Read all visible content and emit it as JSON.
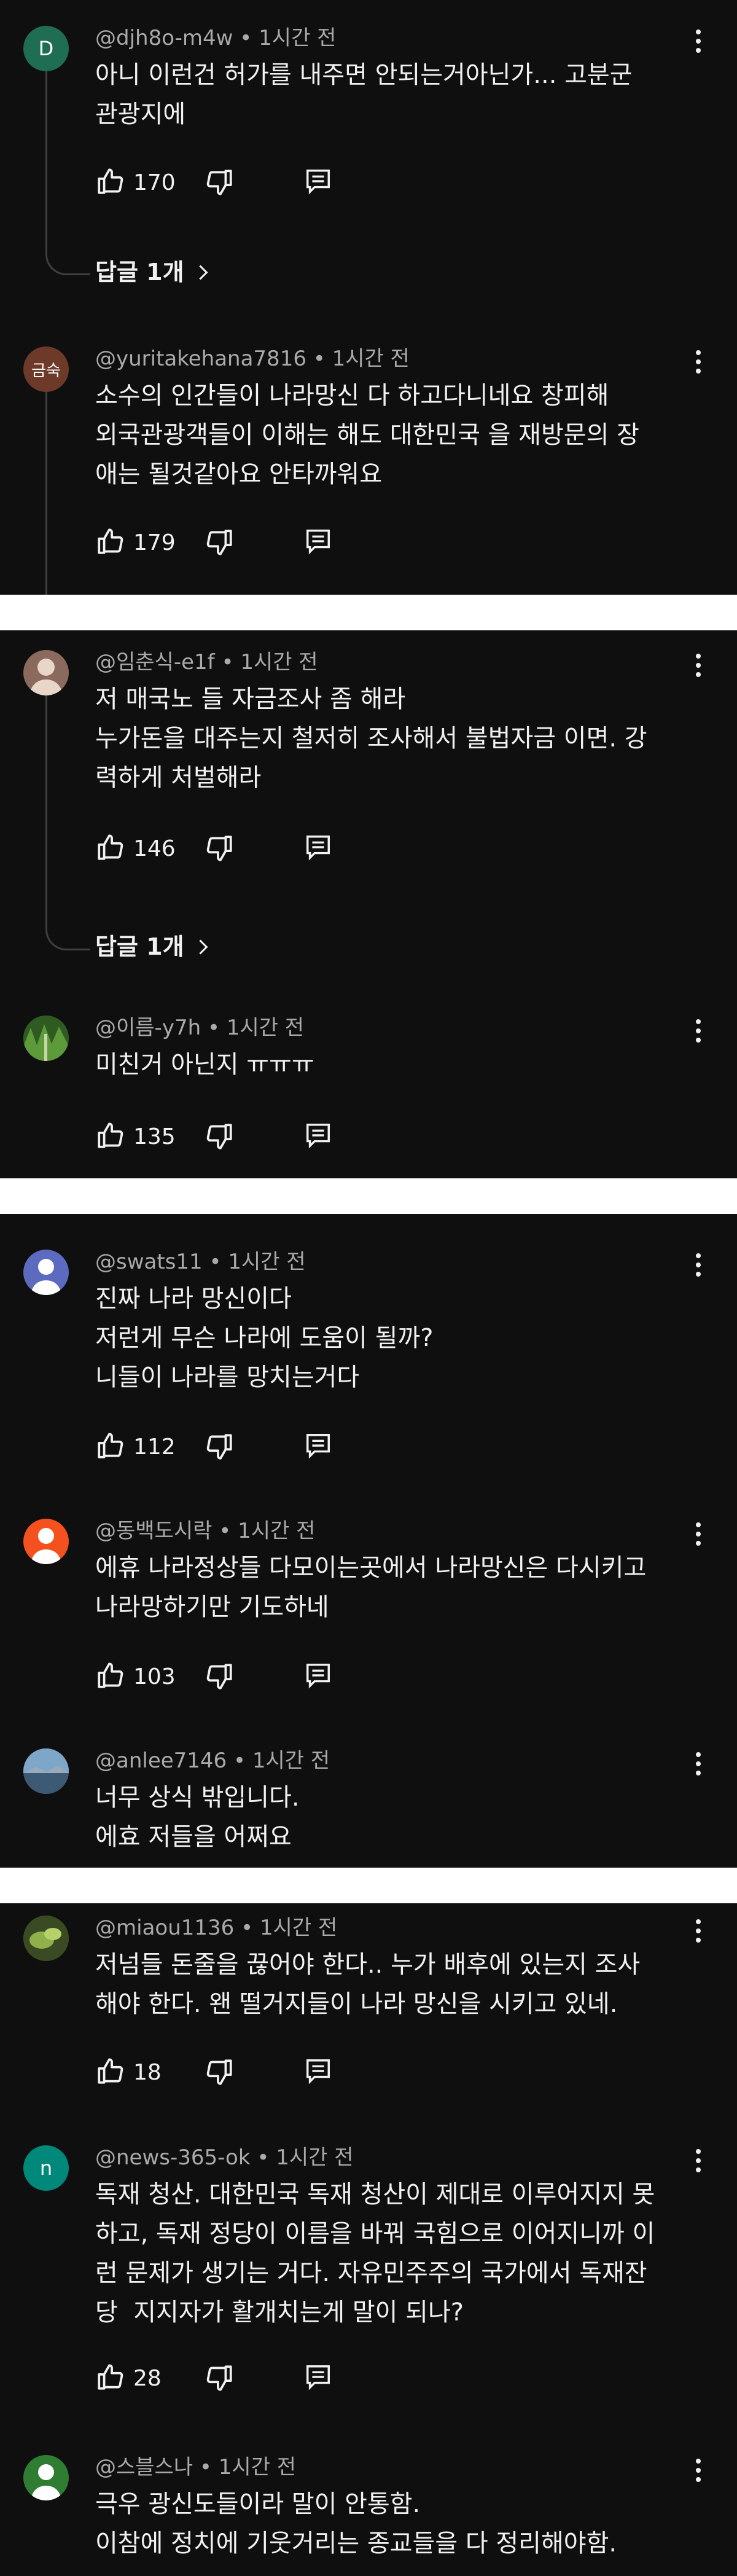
{
  "comments": [
    {
      "author": "@djh8o-m4w",
      "time": "1시간 전",
      "text": "아니 이런건 허가를 내주면 안되는거아닌가... 고분군\n관광지에",
      "likes": "170",
      "avatar": {
        "letter": "D",
        "color": "#1f6d52"
      }
    },
    {
      "author": "@yuritakehana7816",
      "time": "1시간 전",
      "text": "소수의 인간들이 나라망신 다 하고다니네요 창피해\n외국관광객들이 이해는 해도 대한민국 을 재방문의 장\n애는 될것같아요 안타까워요",
      "likes": "179",
      "avatar": {
        "letter": "금숙",
        "color": "#6d3a2a"
      }
    },
    {
      "author": "@임춘식-e1f",
      "time": "1시간 전",
      "text": "저 매국노 들 자금조사 좀 해라\n누가돈을 대주는지 철저히 조사해서 불법자금 이면. 강\n력하게 처벌해라",
      "likes": "146",
      "avatar": {
        "letter": "",
        "color": "#8a6a5c"
      }
    },
    {
      "author": "@이름-y7h",
      "time": "1시간 전",
      "text": "미친거 아닌지 ㅠㅠㅠ",
      "likes": "135",
      "avatar": {
        "letter": "",
        "color": "#3f6a2a"
      }
    },
    {
      "author": "@swats11",
      "time": "1시간 전",
      "text": "진짜 나라 망신이다\n저런게 무슨 나라에 도움이 될까?\n니들이 나라를 망치는거다",
      "likes": "112",
      "avatar": {
        "letter": "",
        "color": "#5c6bc0"
      }
    },
    {
      "author": "@동백도시락",
      "time": "1시간 전",
      "text": "에휴 나라정상들 다모이는곳에서 나라망신은 다시키고\n나라망하기만 기도하네",
      "likes": "103",
      "avatar": {
        "letter": "",
        "color": "#f4511e"
      }
    },
    {
      "author": "@anlee7146",
      "time": "1시간 전",
      "text": "너무 상식 밖입니다.\n에효 저들을 어쩌요",
      "likes": "",
      "avatar": {
        "letter": "",
        "color": "#5a7ea0"
      }
    },
    {
      "author": "@miaou1136",
      "time": "1시간 전",
      "text": "저넘들 돈줄을 끊어야 한다.. 누가 배후에 있는지 조사\n해야 한다. 왠 떨거지들이 나라 망신을 시키고 있네.",
      "likes": "18",
      "avatar": {
        "letter": "",
        "color": "#4a5a2a"
      }
    },
    {
      "author": "@news-365-ok",
      "time": "1시간 전",
      "text": "독재 청산. 대한민국 독재 청산이 제대로 이루어지지 못\n하고, 독재 정당이 이름을 바꿔 국힘으로 이어지니까 이\n런 문제가 생기는 거다. 자유민주주의 국가에서 독재잔\n당  지지자가 활개치는게 말이 되나?",
      "likes": "28",
      "avatar": {
        "letter": "n",
        "color": "#00897b"
      }
    },
    {
      "author": "@스블스나",
      "time": "1시간 전",
      "text": "극우 광신도들이라 말이 안통함.\n이참에 정치에 기웃거리는 종교들을 다 정리해야함.",
      "likes": "",
      "avatar": {
        "letter": "",
        "color": "#2e7d32"
      }
    }
  ],
  "replies": [
    {
      "label": "답글 1개"
    },
    {
      "label": "답글 1개"
    }
  ],
  "icons": {
    "like": "thumbs-up-icon",
    "dislike": "thumbs-down-icon",
    "reply": "reply-comment-icon",
    "more": "more-vert-icon",
    "chevron": "chevron-right-icon"
  }
}
